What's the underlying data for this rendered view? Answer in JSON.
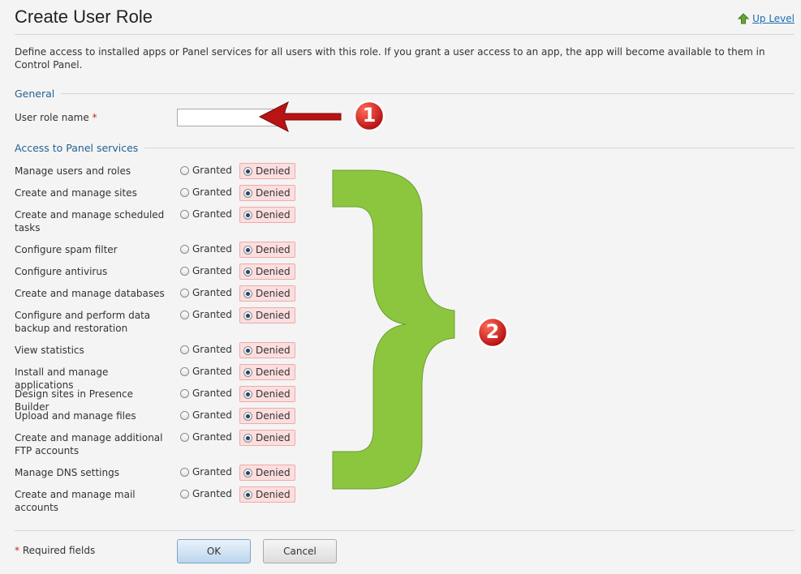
{
  "page_title": "Create User Role",
  "up_level": "Up Level",
  "intro": "Define access to installed apps or Panel services for all users with this role. If you grant a user access to an app, the app will become available to them in Control Panel.",
  "general": {
    "heading": "General",
    "user_role_label": "User role name",
    "required_mark": "*",
    "user_role_value": ""
  },
  "access": {
    "heading": "Access to Panel services",
    "granted_label": "Granted",
    "denied_label": "Denied",
    "rows": [
      {
        "label": "Manage users and roles",
        "value": "Denied"
      },
      {
        "label": "Create and manage sites",
        "value": "Denied"
      },
      {
        "label": "Create and manage scheduled tasks",
        "value": "Denied"
      },
      {
        "label": "Configure spam filter",
        "value": "Denied"
      },
      {
        "label": "Configure antivirus",
        "value": "Denied"
      },
      {
        "label": "Create and manage databases",
        "value": "Denied"
      },
      {
        "label": "Configure and perform data backup and restoration",
        "value": "Denied"
      },
      {
        "label": "View statistics",
        "value": "Denied"
      },
      {
        "label": "Install and manage applications",
        "value": "Denied"
      },
      {
        "label": "Design sites in Presence Builder",
        "value": "Denied"
      },
      {
        "label": "Upload and manage files",
        "value": "Denied"
      },
      {
        "label": "Create and manage additional FTP accounts",
        "value": "Denied"
      },
      {
        "label": "Manage DNS settings",
        "value": "Denied"
      },
      {
        "label": "Create and manage mail accounts",
        "value": "Denied"
      }
    ]
  },
  "footer": {
    "required_fields": "Required fields",
    "required_mark": "*",
    "ok_label": "OK",
    "cancel_label": "Cancel"
  },
  "annotations": {
    "marker_1": "1",
    "marker_2": "2",
    "arrow_color": "#b81414",
    "brace_color": "#8cc63f",
    "marker_color": "#d42020"
  },
  "icons": {
    "up_level": "up-arrow-icon",
    "arrow": "arrow-left-icon",
    "brace": "right-curly-brace"
  }
}
